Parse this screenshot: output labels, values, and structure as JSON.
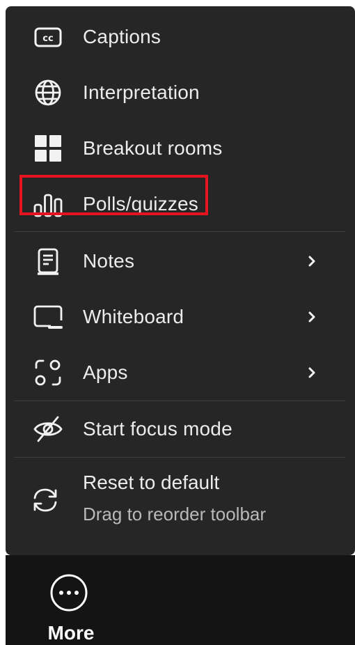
{
  "menu": {
    "items": [
      {
        "label": "Captions",
        "icon": "cc-icon"
      },
      {
        "label": "Interpretation",
        "icon": "globe-icon"
      },
      {
        "label": "Breakout rooms",
        "icon": "grid-icon"
      },
      {
        "label": "Polls/quizzes",
        "icon": "bar-chart-icon"
      },
      {
        "label": "Notes",
        "icon": "notes-icon"
      },
      {
        "label": "Whiteboard",
        "icon": "whiteboard-icon"
      },
      {
        "label": "Apps",
        "icon": "apps-icon"
      },
      {
        "label": "Start focus mode",
        "icon": "eye-slash-icon"
      }
    ],
    "reset": {
      "title": "Reset to default",
      "subtitle": "Drag to reorder toolbar",
      "icon": "refresh-icon"
    }
  },
  "bottombar": {
    "more_label": "More",
    "more_icon": "ellipsis-circle-icon"
  },
  "colors": {
    "menu_bg": "#262626",
    "bar_bg": "#141414",
    "highlight": "#e6141e",
    "text": "#ececec"
  }
}
